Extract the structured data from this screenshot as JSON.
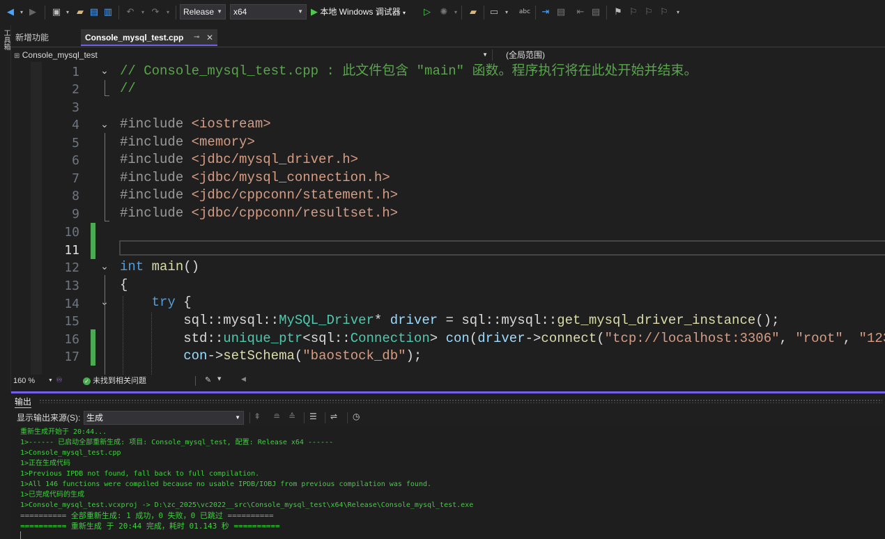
{
  "toolbar": {
    "configuration": "Release",
    "platform": "x64",
    "debugger_label": "本地 Windows 调试器"
  },
  "tabs": [
    {
      "label": "新增功能"
    },
    {
      "label": "Console_mysql_test.cpp"
    }
  ],
  "navbar": {
    "project": "Console_mysql_test",
    "scope": "(全局范围)"
  },
  "left_strip": {
    "label": "工具箱"
  },
  "editor": {
    "line_numbers": [
      "1",
      "2",
      "3",
      "4",
      "5",
      "6",
      "7",
      "8",
      "9",
      "10",
      "11",
      "12",
      "13",
      "14",
      "15",
      "16",
      "17"
    ],
    "current_line": "11"
  },
  "status": {
    "zoom": "160 %",
    "issues": "未找到相关问题"
  },
  "output": {
    "title": "输出",
    "source_label": "显示输出来源(S):",
    "source_value": "生成",
    "lines": [
      "重新生成开始于 20:44...",
      "1>------ 已启动全部重新生成: 项目: Console_mysql_test, 配置: Release x64 ------",
      "1>Console_mysql_test.cpp",
      "1>正在生成代码",
      "1>Previous IPDB not found, fall back to full compilation.",
      "1>All 146 functions were compiled because no usable IPDB/IOBJ from previous compilation was found.",
      "1>已完成代码的生成",
      "1>Console_mysql_test.vcxproj -> D:\\zc_2025\\vc2022__src\\Console_mysql_test\\x64\\Release\\Console_mysql_test.exe",
      "========== 全部重新生成: 1 成功，0 失败，0 已跳过 ==========",
      "========== 重新生成 于 20:44 完成，耗时 01.143 秒 =========="
    ]
  },
  "colors": {
    "accent": "#7160e8",
    "output_text": "#3fd13f",
    "change_marker": "#4cab52",
    "comment": "#57a64a",
    "keyword": "#569cd6",
    "string": "#d69d85"
  }
}
